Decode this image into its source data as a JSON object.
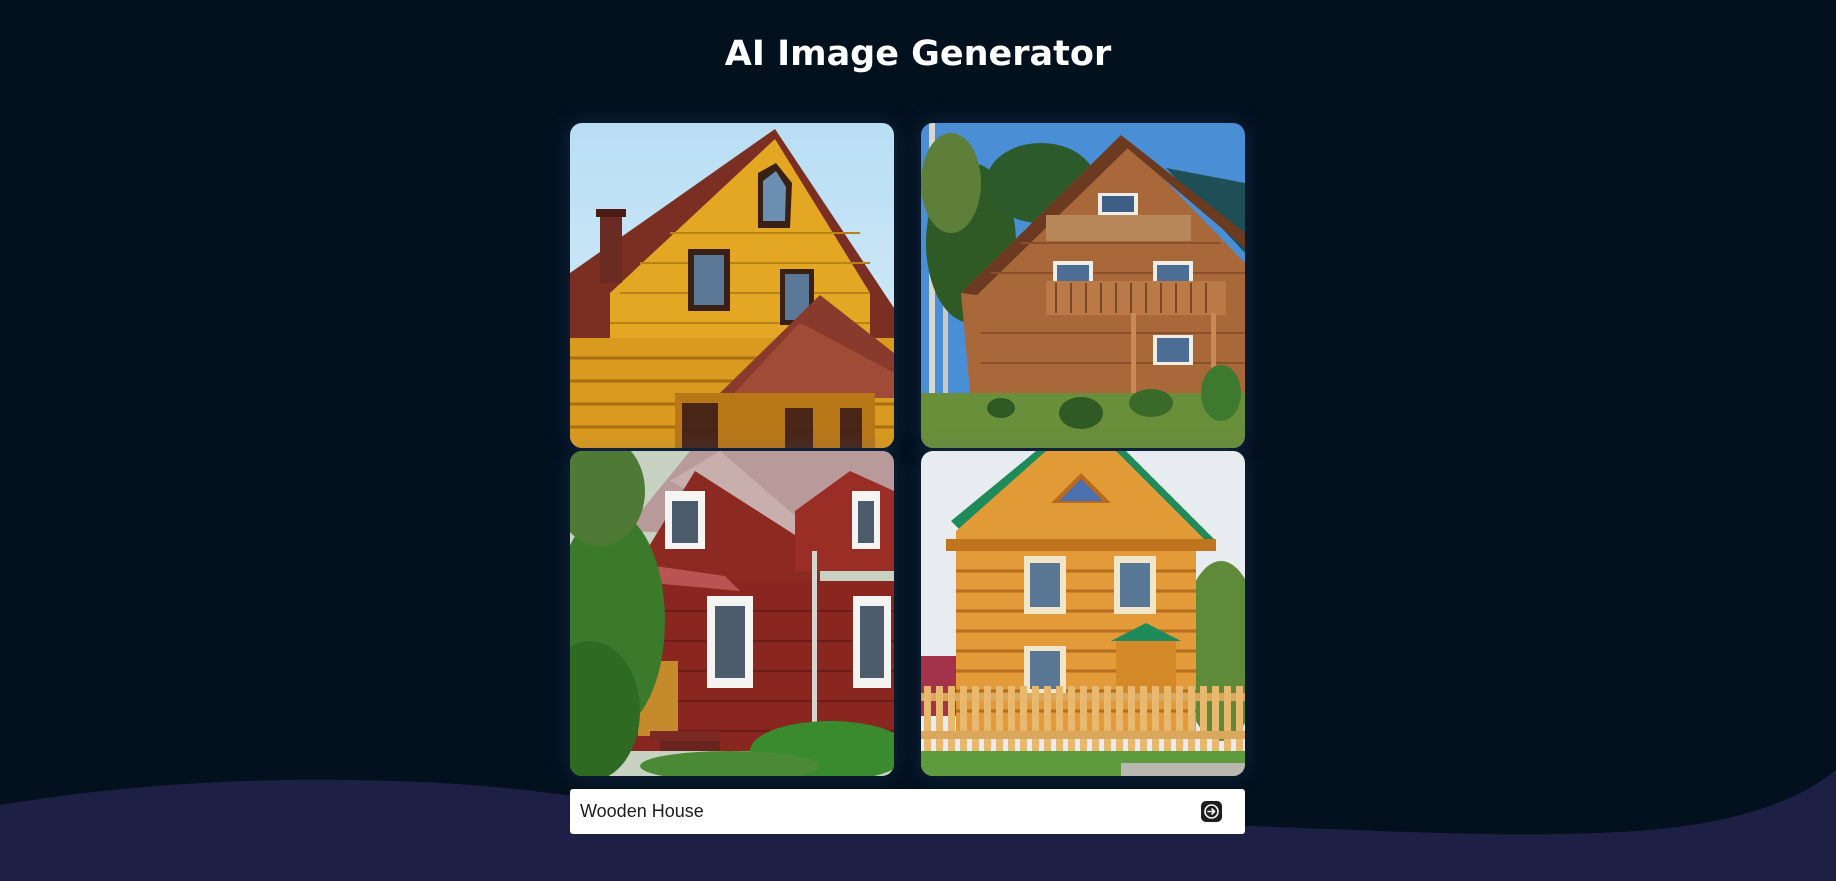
{
  "header": {
    "title": "AI Image Generator"
  },
  "gallery": {
    "images": [
      {
        "subject": "yellow wooden house with red roof"
      },
      {
        "subject": "brown log house with balcony"
      },
      {
        "subject": "red wooden house with white windows"
      },
      {
        "subject": "orange log house with green roof and fence"
      }
    ]
  },
  "prompt": {
    "value": "Wooden House",
    "submit_icon": "arrow-right-circle-icon"
  },
  "colors": {
    "background": "#03111f",
    "wave": "#1e1f44",
    "input_background": "#ffffff",
    "title": "#ffffff"
  }
}
